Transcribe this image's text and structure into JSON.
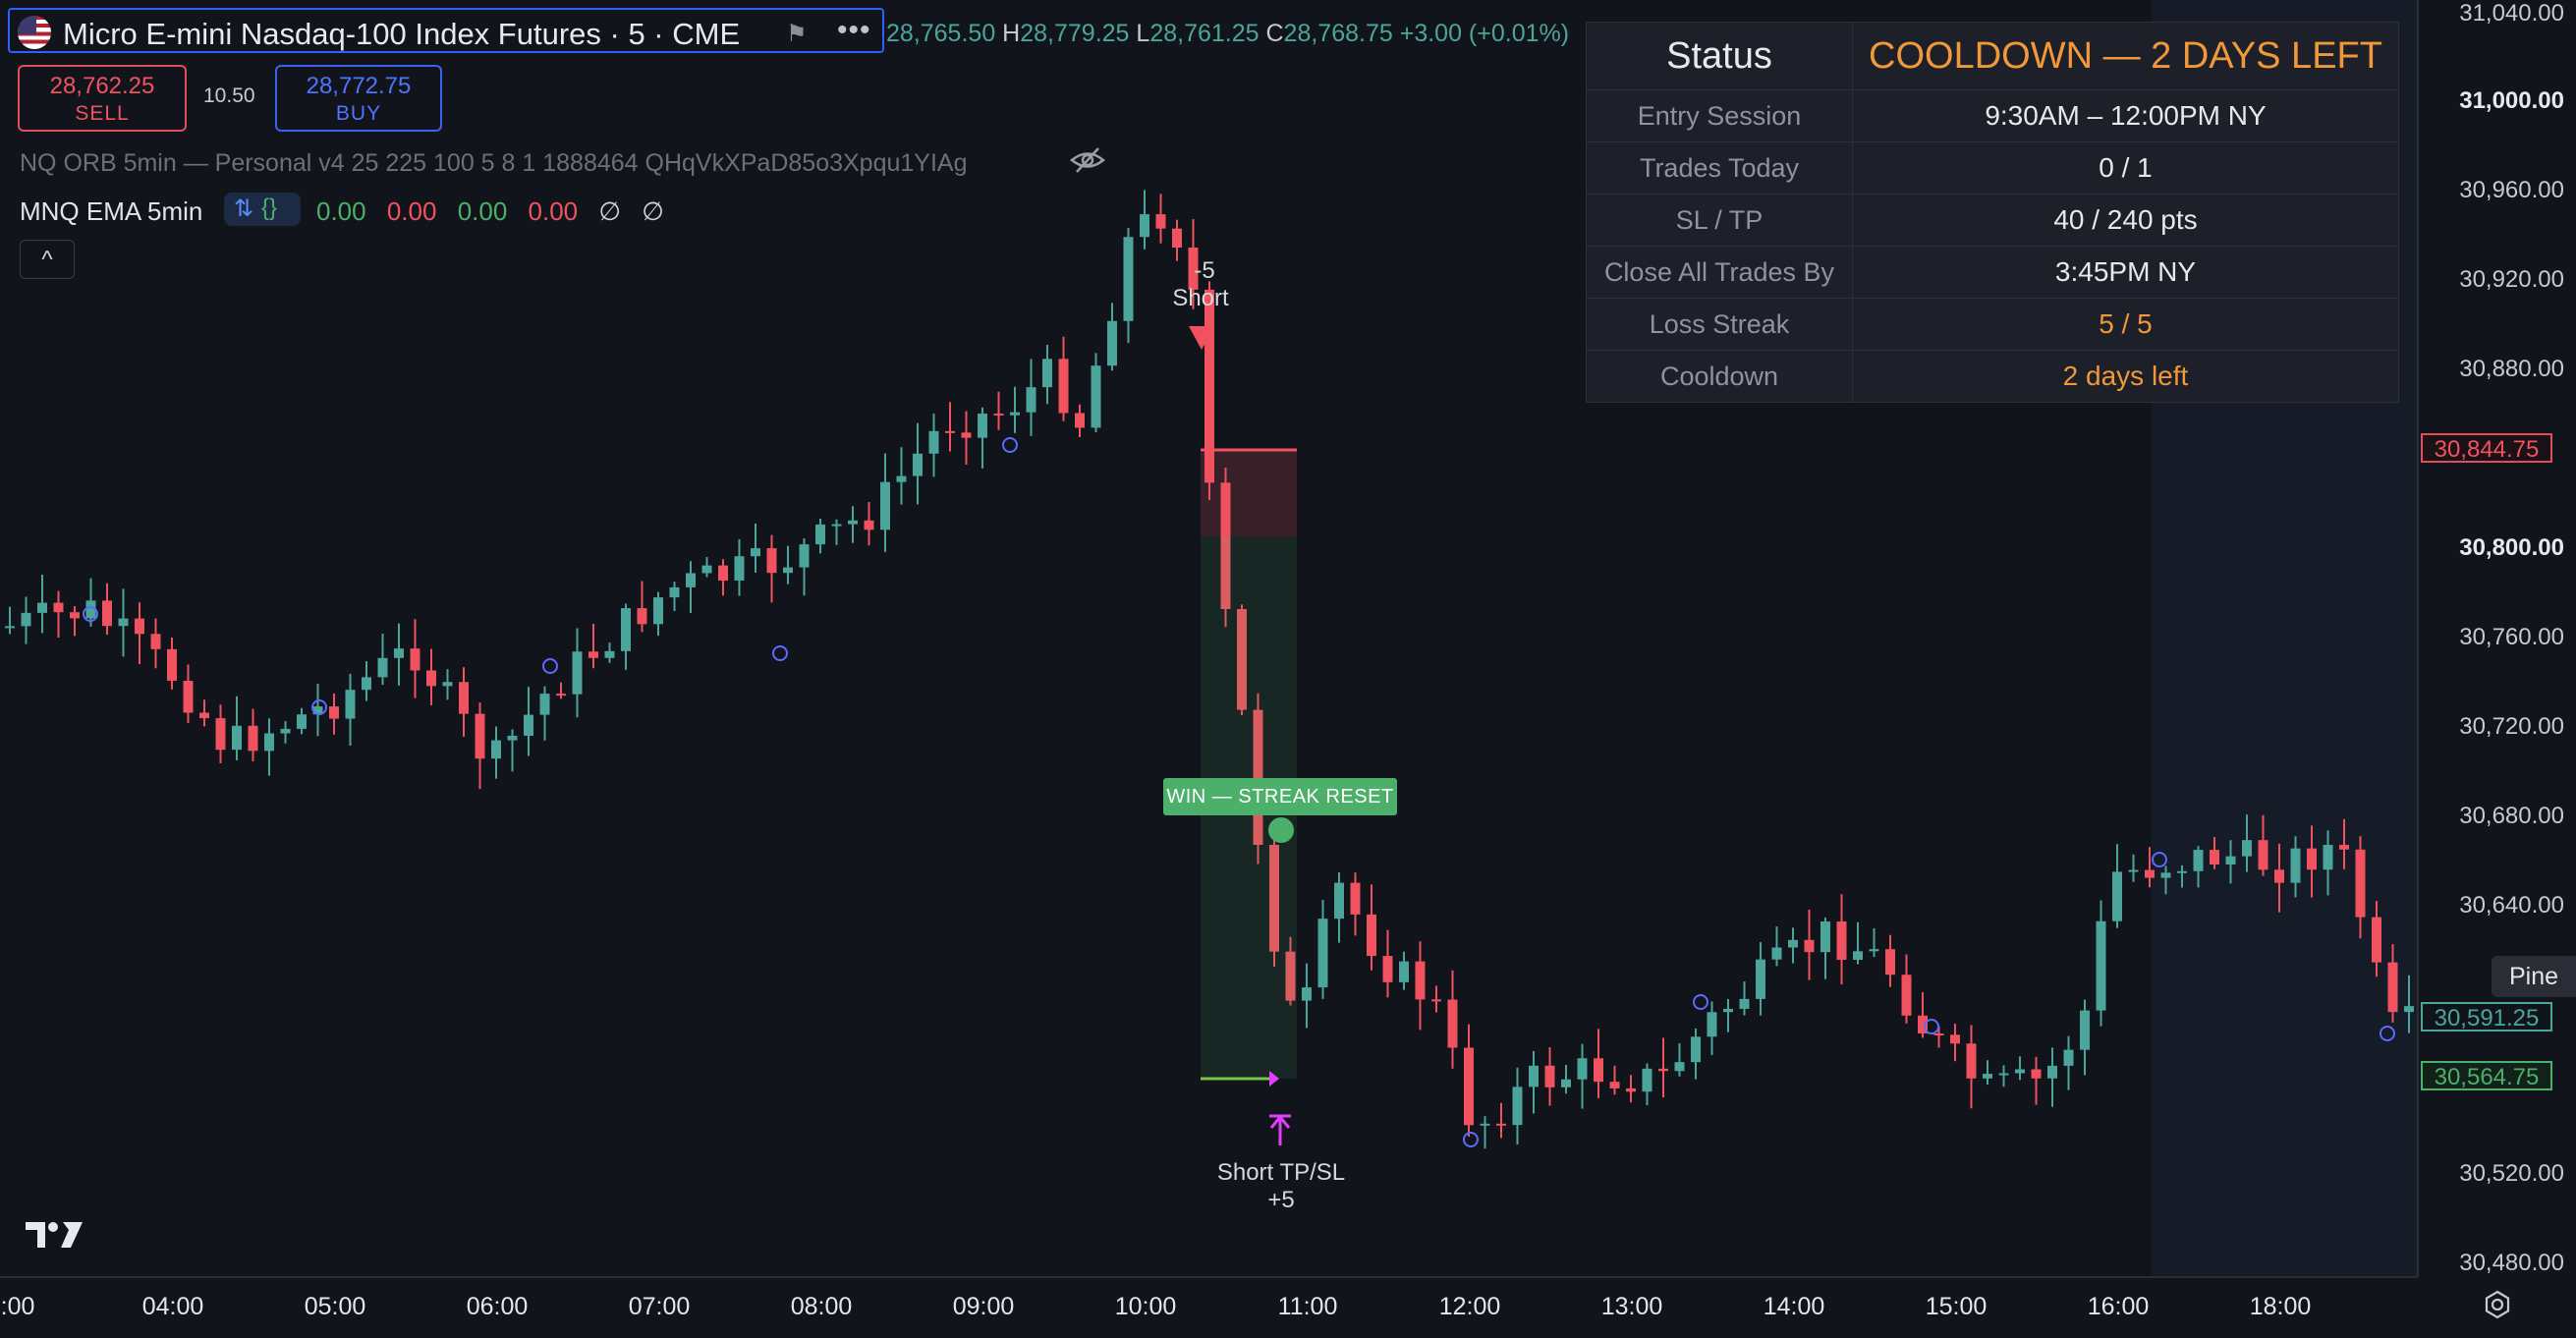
{
  "header": {
    "symbol_title": "Micro E-mini Nasdaq-100 Index Futures · 5 · CME",
    "more_label": "•••",
    "ohlc": {
      "o_value": "28,765.50",
      "h_label": "H",
      "h_value": "28,779.25",
      "l_label": "L",
      "l_value": "28,761.25",
      "c_label": "C",
      "c_value": "28,768.75",
      "change": "+3.00 (+0.01%)"
    }
  },
  "trade": {
    "sell_price": "28,762.25",
    "sell_label": "SELL",
    "spread": "10.50",
    "buy_price": "28,772.75",
    "buy_label": "BUY"
  },
  "indicators": {
    "strategy": "NQ ORB 5min — Personal v4 25 225 100 5 8 1 1888464 QHqVkXPaD85o3Xpqu1YIAg",
    "ema_name": "MNQ EMA 5min",
    "ema_pill_icons": [
      "arrows-icon",
      "braces-icon"
    ],
    "ema_values": [
      "0.00",
      "0.00",
      "0.00",
      "0.00",
      "∅",
      "∅"
    ],
    "collapse": "^"
  },
  "status_table": {
    "title_key": "Status",
    "title_value": "COOLDOWN — 2 DAYS LEFT",
    "rows": [
      {
        "key": "Entry Session",
        "value": "9:30AM – 12:00PM NY"
      },
      {
        "key": "Trades Today",
        "value": "0 / 1"
      },
      {
        "key": "SL / TP",
        "value": "40 / 240 pts"
      },
      {
        "key": "Close All Trades By",
        "value": "3:45PM NY"
      },
      {
        "key": "Loss Streak",
        "value": "5 / 5"
      },
      {
        "key": "Cooldown",
        "value": "2 days left"
      }
    ]
  },
  "price_axis": {
    "labels": [
      "31,040.00",
      "31,000.00",
      "30,960.00",
      "30,920.00",
      "30,880.00",
      "30,800.00",
      "30,760.00",
      "30,720.00",
      "30,680.00",
      "30,640.00",
      "30,520.00",
      "30,480.00"
    ],
    "tag_stop": "30,844.75",
    "tag_last": "30,591.25",
    "tag_target": "30,564.75",
    "pine": "Pine"
  },
  "time_axis": {
    "labels": [
      ":00",
      "04:00",
      "05:00",
      "06:00",
      "07:00",
      "08:00",
      "09:00",
      "10:00",
      "11:00",
      "12:00",
      "13:00",
      "14:00",
      "15:00",
      "16:00",
      "18:00"
    ]
  },
  "annotations": {
    "entry_qty": "-5",
    "entry_label": "Short",
    "exit_label": "Short TP/SL",
    "exit_qty": "+5",
    "win_badge": "WIN — STREAK RESET"
  },
  "colors": {
    "up": "#4ba59a",
    "down": "#f0525f",
    "background": "#12141b",
    "highlight": "#f0983a",
    "session_shade": "#161b28"
  }
}
